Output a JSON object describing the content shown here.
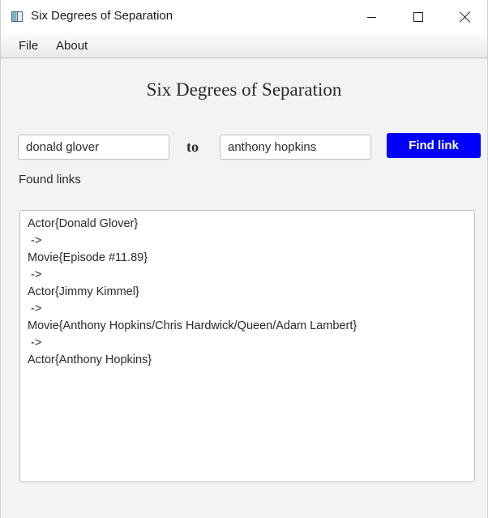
{
  "window": {
    "title": "Six Degrees of Separation"
  },
  "menu": {
    "file": "File",
    "about": "About"
  },
  "main": {
    "heading": "Six Degrees of Separation",
    "from_value": "donald glover",
    "to_label": "to",
    "to_value": "anthony hopkins",
    "find_button": "Find link",
    "found_label": "Found links",
    "results": [
      "Actor{Donald Glover}",
      " ->",
      "Movie{Episode #11.89}",
      " ->",
      "Actor{Jimmy Kimmel}",
      " ->",
      "Movie{Anthony Hopkins/Chris Hardwick/Queen/Adam Lambert}",
      " ->",
      "Actor{Anthony Hopkins}"
    ]
  },
  "colors": {
    "find_button_bg": "#0000ff",
    "find_button_text": "#ffffff"
  },
  "icons": {
    "app": "app-window-icon",
    "minimize": "minimize-icon",
    "maximize": "maximize-icon",
    "close": "close-icon"
  }
}
